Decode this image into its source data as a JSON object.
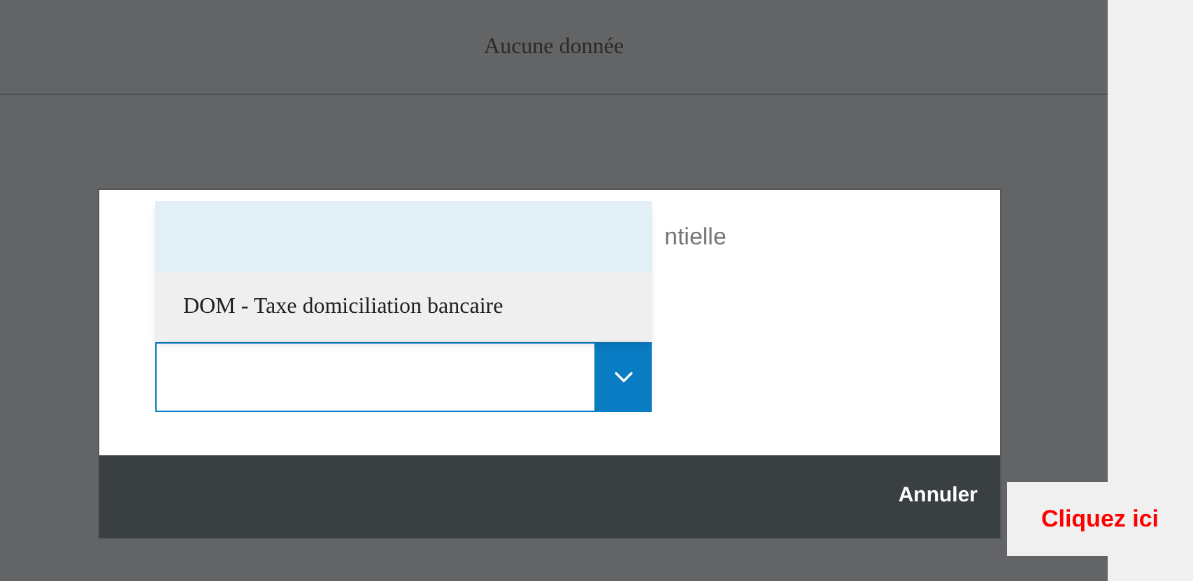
{
  "header": {
    "title": "Aucune donnée"
  },
  "modal": {
    "label_partial": "ntielle",
    "dropdown": {
      "blank_option_highlighted": true,
      "options": [
        {
          "label": "DOM - Taxe domiciliation bancaire",
          "selected": false
        }
      ]
    },
    "footer": {
      "cancel_button": "Annuler"
    }
  },
  "callout": {
    "text": "Cliquez ici"
  }
}
